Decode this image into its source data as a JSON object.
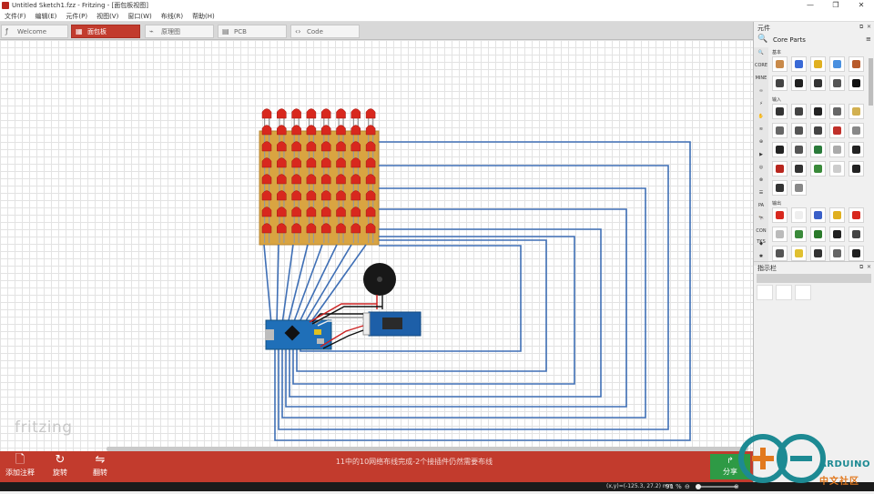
{
  "window": {
    "title": "Untitled Sketch1.fzz - Fritzing - [面包板视图]",
    "controls": [
      "—",
      "❐",
      "✕"
    ]
  },
  "menu": [
    "文件(F)",
    "编辑(E)",
    "元件(P)",
    "视图(V)",
    "窗口(W)",
    "布线(R)",
    "帮助(H)"
  ],
  "tabs": [
    {
      "label": "Welcome",
      "icon": "welcome-icon",
      "glyph": "ƒ",
      "active": false
    },
    {
      "label": "面包板",
      "icon": "breadboard-icon",
      "glyph": "▦",
      "active": true
    },
    {
      "label": "原理图",
      "icon": "schematic-icon",
      "glyph": "⌁",
      "active": false
    },
    {
      "label": "PCB",
      "icon": "pcb-icon",
      "glyph": "▤",
      "active": false
    },
    {
      "label": "Code",
      "icon": "code-icon",
      "glyph": "‹›",
      "active": false
    }
  ],
  "canvas": {
    "watermark": "fritzing",
    "led_matrix": {
      "rows": 8,
      "cols": 8,
      "led_color": "#d8281e",
      "board_color": "#d9a441"
    },
    "wire_color": "#3f6fb5"
  },
  "bottom": {
    "add_note": "添加注释",
    "rotate": "旋转",
    "flip": "翻转",
    "routing_status": "11中的10网络布线完成-2个接插件仍然需要布线",
    "share": "分享"
  },
  "status": {
    "coords": "(x,y)=(-125.3, 27.2) mm",
    "zoom": "91 %"
  },
  "parts_panel": {
    "title": "元件",
    "bin_name": "Core Parts",
    "side_tabs": [
      "🔍",
      "CORE",
      "MINE",
      "∞",
      "⚡",
      "✋",
      "≋",
      "⊕",
      "▶",
      "◎",
      "⊗",
      "☰",
      "PA",
      "🐄",
      "CON TKS",
      "◆",
      "✱"
    ],
    "sections": [
      "基本",
      "输入",
      "输出"
    ],
    "part_colors": {
      "basic": [
        "#c98a4a",
        "#3a6ad6",
        "#e0b020",
        "#4a90e0",
        "#b85a2a",
        "#444",
        "#222",
        "#333",
        "#555",
        "#111"
      ],
      "input": [
        "#333",
        "#444",
        "#222",
        "#666",
        "#d2b050",
        "#666",
        "#555",
        "#444",
        "#c0302a",
        "#888",
        "#222",
        "#555",
        "#2a7a3a",
        "#aaa",
        "#222",
        "#b8261e",
        "#333",
        "#3a8a3a",
        "#ccc",
        "#222",
        "#333",
        "#888"
      ],
      "output": [
        "#d8281e",
        "#eee",
        "#3a60c8",
        "#e0b020",
        "#d8281e",
        "#bbb",
        "#3a8a3a",
        "#2a7a2a",
        "#222",
        "#444",
        "#555",
        "#e0c030",
        "#333",
        "#666",
        "#222"
      ]
    }
  },
  "inspector": {
    "title": "指示栏"
  },
  "watermark_logo": {
    "line1": "ARDUINO",
    "line2": "中文社区"
  }
}
